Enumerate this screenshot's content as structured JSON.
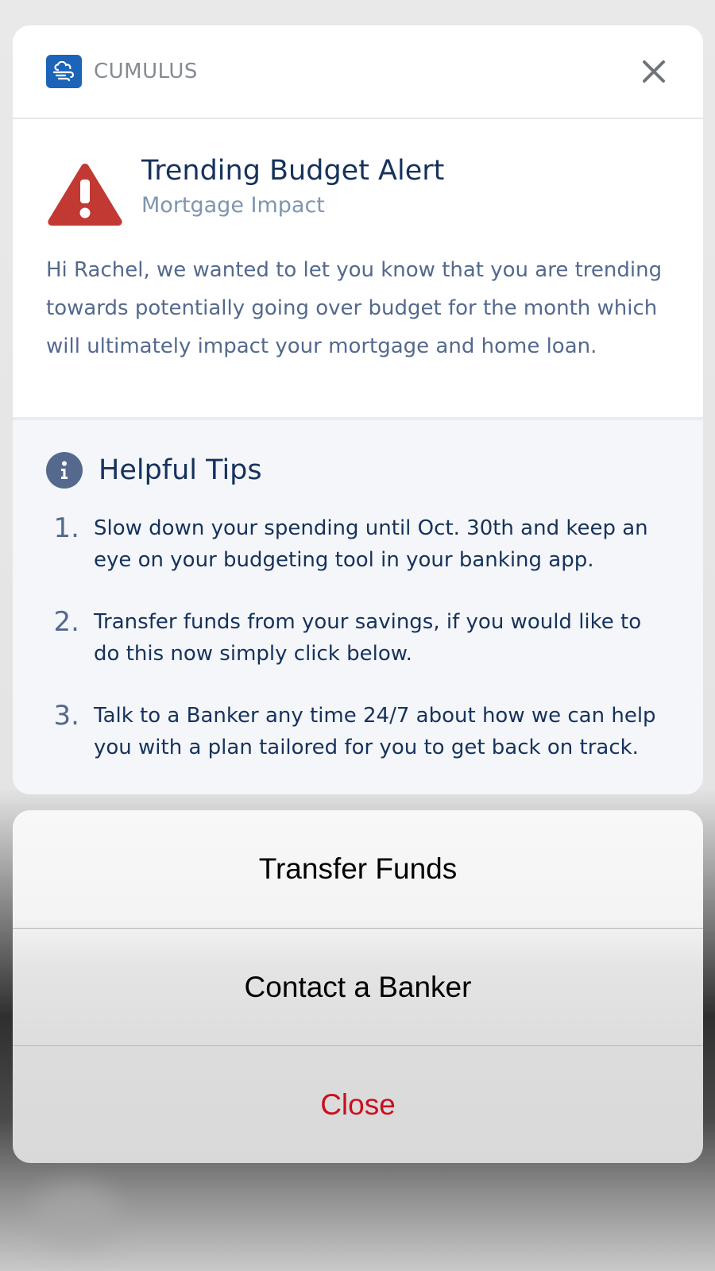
{
  "app": {
    "name": "CUMULUS"
  },
  "alert": {
    "title": "Trending Budget Alert",
    "subtitle": "Mortgage Impact",
    "body": "Hi Rachel, we wanted to let you know that you are trending towards potentially going over budget for the month which will ultimately impact your mortgage and home loan."
  },
  "tips": {
    "title": "Helpful Tips",
    "items": [
      {
        "num": "1.",
        "text": "Slow down your spending until Oct. 30th and keep an eye on your budgeting tool in your banking app."
      },
      {
        "num": "2.",
        "text": "Transfer funds from your savings, if you would like to do this now simply click below."
      },
      {
        "num": "3.",
        "text": "Talk to a Banker any time 24/7 about how we can help you with a plan tailored for you to get back on track."
      }
    ]
  },
  "actions": {
    "transfer_label": "Transfer Funds",
    "contact_label": "Contact a Banker",
    "close_label": "Close"
  },
  "colors": {
    "brand": "#1b64b8",
    "alert_red": "#c23934",
    "navy_text": "#16325c",
    "muted_text": "#54698d",
    "destructive": "#c8101f"
  },
  "icons": {
    "app_logo": "cloud-wind-icon",
    "header_close": "close-icon",
    "alert": "warning-icon",
    "tips": "info-icon"
  }
}
